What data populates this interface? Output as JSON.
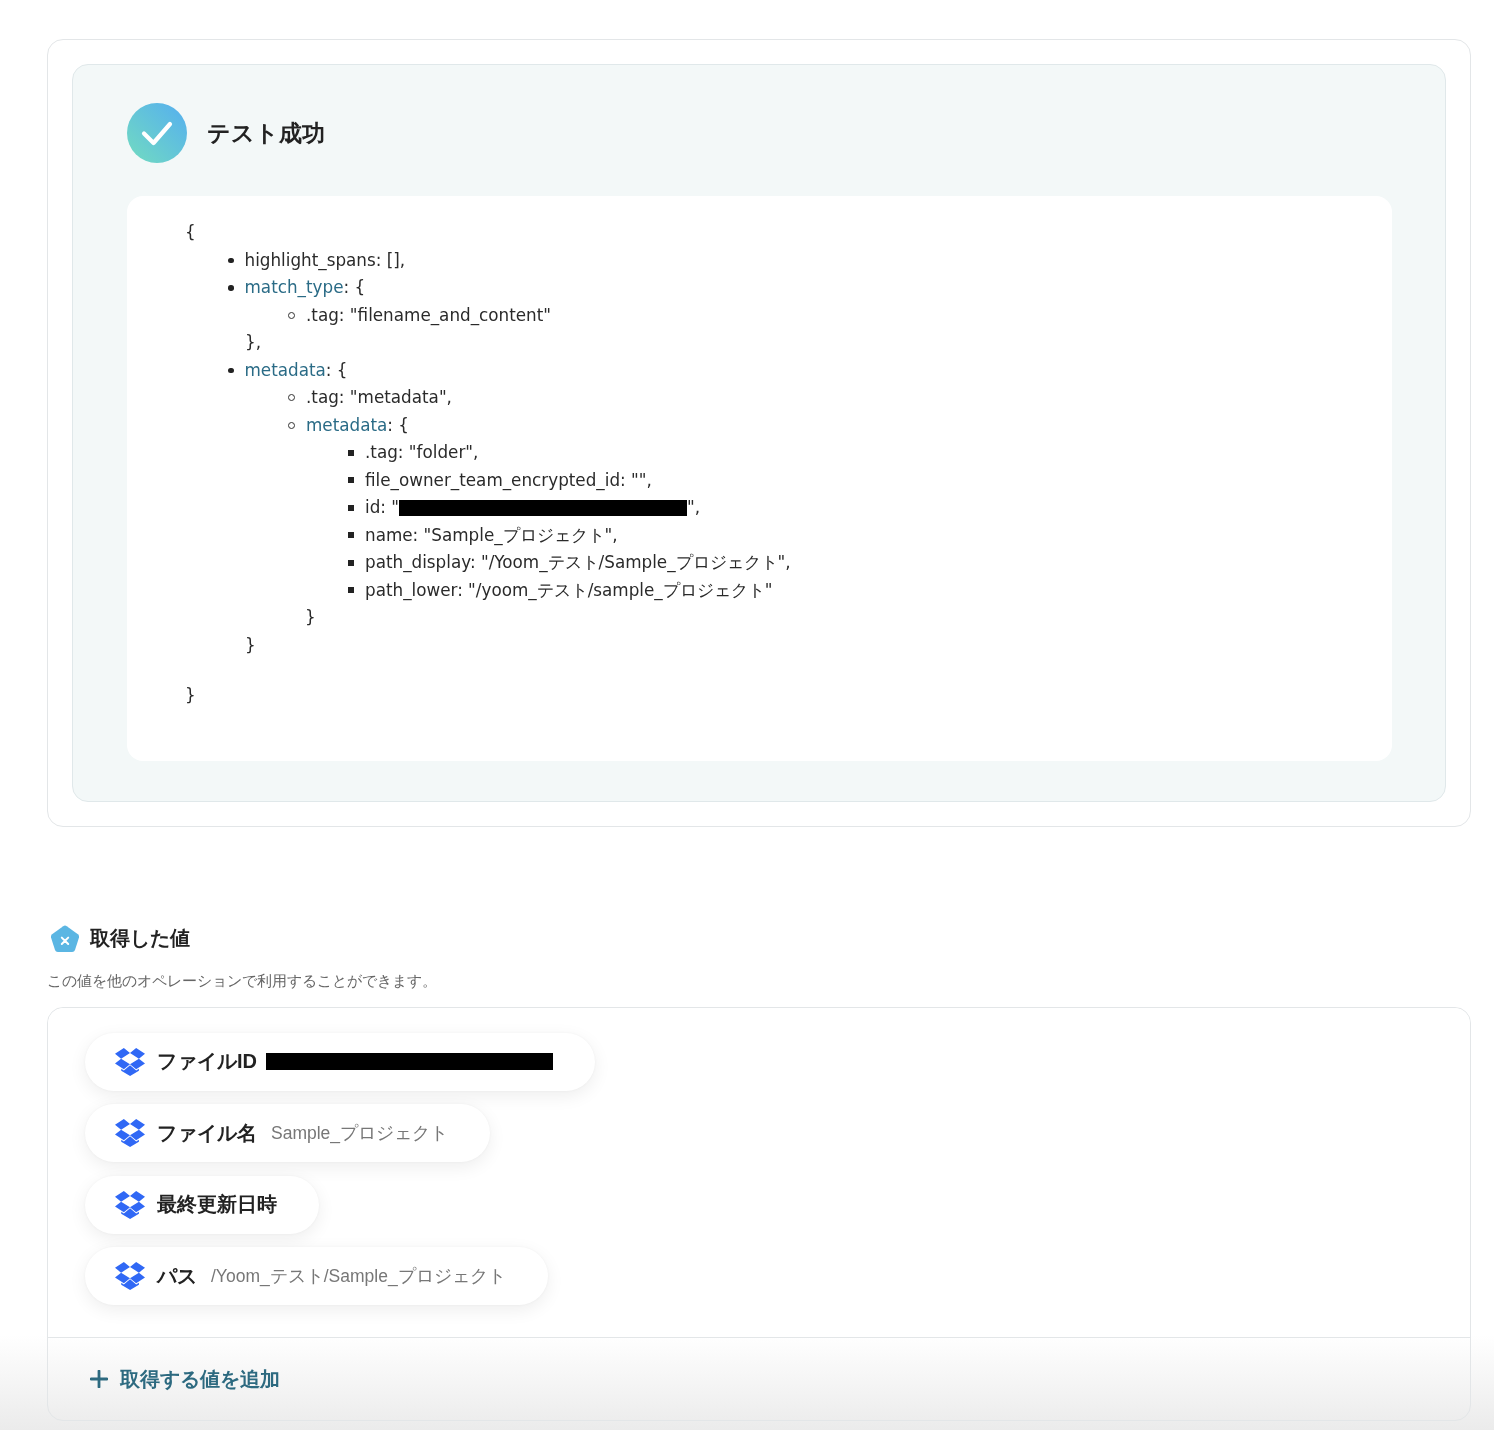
{
  "test_result": {
    "title": "テスト成功",
    "output": {
      "open": "{",
      "entries": [
        {
          "key": "highlight_spans",
          "rest": ": [],",
          "link": false,
          "redacted": false
        },
        {
          "key": "match_type",
          "rest": ": {",
          "link": true,
          "redacted": false,
          "children": [
            {
              "key": ".tag",
              "rest": ": \"filename_and_content\"",
              "link": false,
              "redacted": false
            }
          ],
          "close": "},"
        },
        {
          "key": "metadata",
          "rest": ": {",
          "link": true,
          "redacted": false,
          "children": [
            {
              "key": ".tag",
              "rest": ": \"metadata\",",
              "link": false,
              "redacted": false
            },
            {
              "key": "metadata",
              "rest": ": {",
              "link": true,
              "redacted": false,
              "children": [
                {
                  "key": ".tag",
                  "rest": ": \"folder\",",
                  "link": false,
                  "redacted": false
                },
                {
                  "key": "file_owner_team_encrypted_id",
                  "rest": ": \"\",",
                  "link": false,
                  "redacted": false
                },
                {
                  "key": "id",
                  "rest": ": \"",
                  "link": false,
                  "redacted": true,
                  "after": "\","
                },
                {
                  "key": "name",
                  "rest": ": \"Sample_プロジェクト\",",
                  "link": false,
                  "redacted": false
                },
                {
                  "key": "path_display",
                  "rest": ": \"/Yoom_テスト/Sample_プロジェクト\",",
                  "link": false,
                  "redacted": false
                },
                {
                  "key": "path_lower",
                  "rest": ": \"/yoom_テスト/sample_プロジェクト\"",
                  "link": false,
                  "redacted": false
                }
              ],
              "close": "}"
            }
          ],
          "close": "}"
        }
      ],
      "close": "}"
    }
  },
  "fetched_values": {
    "title": "取得した値",
    "description": "この値を他のオペレーションで利用することができます。",
    "items": [
      {
        "label": "ファイルID",
        "redacted": true
      },
      {
        "label": "ファイル名",
        "value": "Sample_プロジェクト",
        "redacted": false
      },
      {
        "label": "最終更新日時",
        "redacted": false
      },
      {
        "label": "パス",
        "value": "/Yoom_テスト/Sample_プロジェクト",
        "redacted": false
      }
    ],
    "add_button": {
      "label": "取得する値を追加"
    }
  }
}
